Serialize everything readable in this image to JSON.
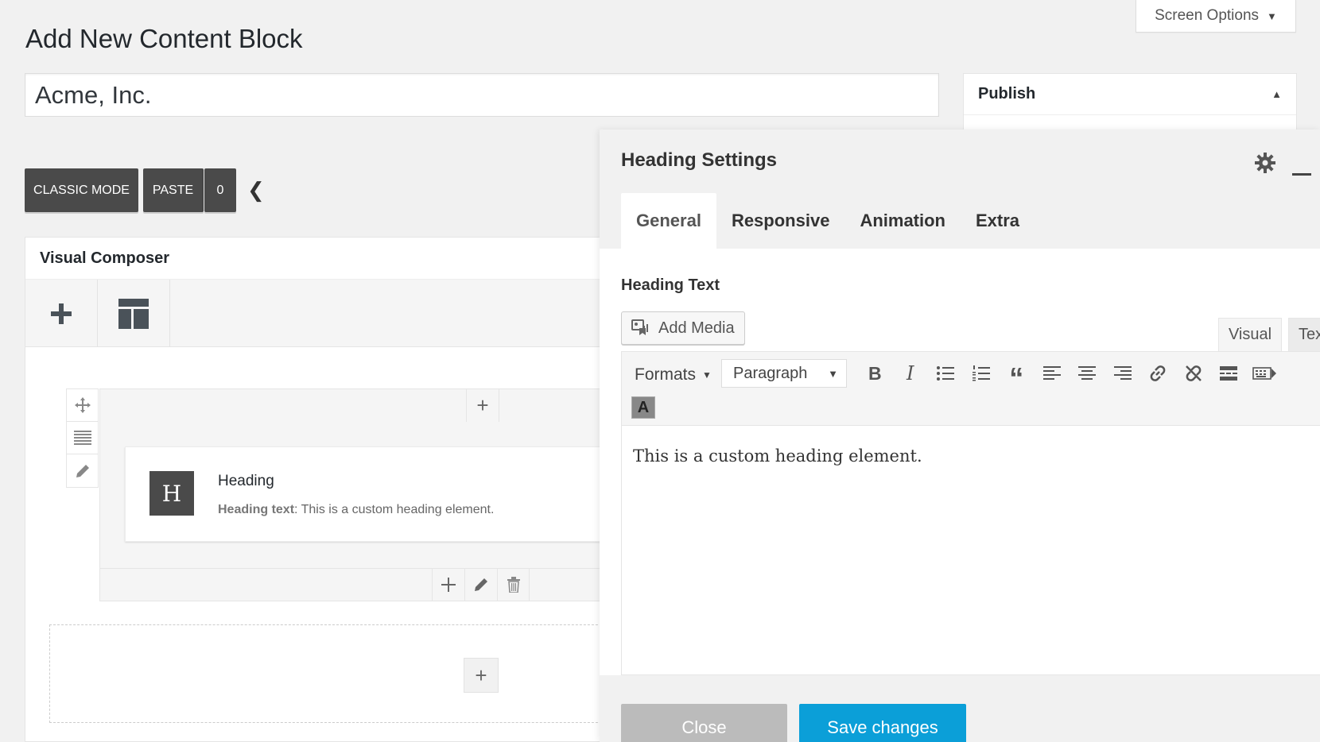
{
  "header": {
    "screen_options": "Screen Options",
    "page_title": "Add New Content Block",
    "post_title": "Acme, Inc."
  },
  "publish": {
    "title": "Publish"
  },
  "toolbar": {
    "classic_mode": "CLASSIC MODE",
    "paste": "PASTE",
    "paste_count": "0"
  },
  "composer": {
    "title": "Visual Composer",
    "element": {
      "badge": "H",
      "title": "Heading",
      "desc_label": "Heading text",
      "desc_value": ": This is a custom heading element."
    }
  },
  "modal": {
    "title": "Heading Settings",
    "tabs": [
      "General",
      "Responsive",
      "Animation",
      "Extra"
    ],
    "field_label": "Heading Text",
    "add_media": "Add Media",
    "mode_visual": "Visual",
    "mode_text": "Tex",
    "formats": "Formats",
    "paragraph": "Paragraph",
    "color_btn": "A",
    "content": "This is a custom heading element.",
    "close": "Close",
    "save": "Save changes"
  },
  "colors": {
    "primary_blue": "#0b9fd8",
    "dark_button": "#4a4a4a",
    "close_gray": "#bbbbbb"
  }
}
